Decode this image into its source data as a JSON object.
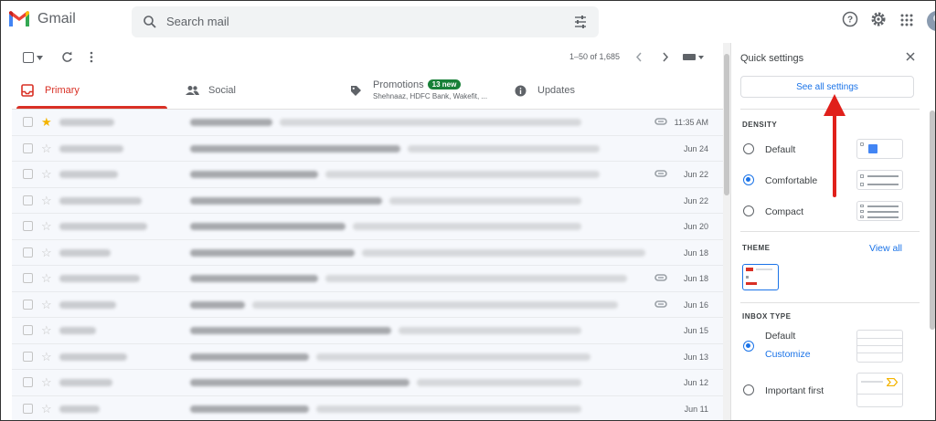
{
  "app": {
    "name": "Gmail",
    "accent_color": "#d93025",
    "link_color": "#1a73e8"
  },
  "search": {
    "placeholder": "Search mail"
  },
  "toolbar": {
    "pagination": "1–50 of 1,685"
  },
  "tabs": [
    {
      "label": "Primary",
      "icon": "inbox-icon",
      "active": true
    },
    {
      "label": "Social",
      "icon": "people-icon",
      "active": false
    },
    {
      "label": "Promotions",
      "icon": "tag-icon",
      "active": false,
      "badge": "13 new",
      "subtitle": "Shehnaaz, HDFC Bank, Wakefit, ..."
    },
    {
      "label": "Updates",
      "icon": "info-icon",
      "active": false
    }
  ],
  "emails": [
    {
      "date": "11:35 AM",
      "starred": true,
      "attachment": true
    },
    {
      "date": "Jun 24",
      "starred": false,
      "attachment": false
    },
    {
      "date": "Jun 22",
      "starred": false,
      "attachment": true
    },
    {
      "date": "Jun 22",
      "starred": false,
      "attachment": false
    },
    {
      "date": "Jun 20",
      "starred": false,
      "attachment": false
    },
    {
      "date": "Jun 18",
      "starred": false,
      "attachment": false
    },
    {
      "date": "Jun 18",
      "starred": false,
      "attachment": true
    },
    {
      "date": "Jun 16",
      "starred": false,
      "attachment": true
    },
    {
      "date": "Jun 15",
      "starred": false,
      "attachment": false
    },
    {
      "date": "Jun 13",
      "starred": false,
      "attachment": false
    },
    {
      "date": "Jun 12",
      "starred": false,
      "attachment": false
    },
    {
      "date": "Jun 11",
      "starred": false,
      "attachment": false
    }
  ],
  "quick_settings": {
    "title": "Quick settings",
    "see_all": "See all settings",
    "density": {
      "heading": "DENSITY",
      "options": [
        {
          "label": "Default",
          "checked": false
        },
        {
          "label": "Comfortable",
          "checked": true
        },
        {
          "label": "Compact",
          "checked": false
        }
      ]
    },
    "theme": {
      "heading": "THEME",
      "view_all": "View all"
    },
    "inbox_type": {
      "heading": "INBOX TYPE",
      "options": [
        {
          "label": "Default",
          "checked": true,
          "link": "Customize"
        },
        {
          "label": "Important first",
          "checked": false
        }
      ]
    }
  },
  "annotation": {
    "arrow_color": "#e0201b"
  }
}
